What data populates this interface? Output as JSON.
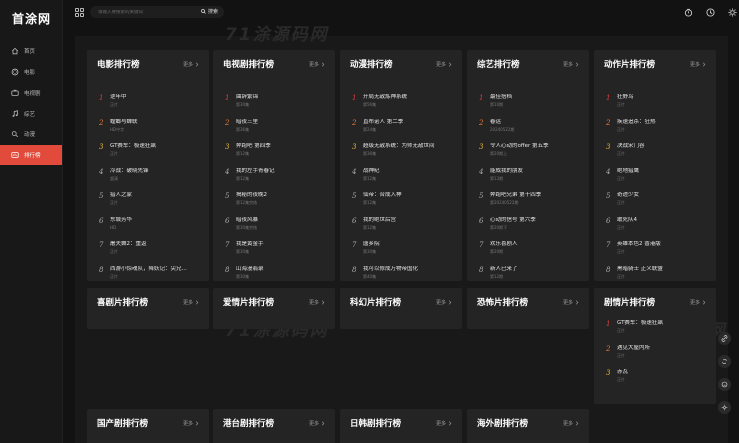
{
  "app": {
    "logo": "首涂网"
  },
  "sidebar": {
    "items": [
      {
        "label": "首页",
        "icon": "home-icon"
      },
      {
        "label": "电影",
        "icon": "film-reel-icon"
      },
      {
        "label": "电视剧",
        "icon": "tv-icon"
      },
      {
        "label": "综艺",
        "icon": "music-note-icon"
      },
      {
        "label": "动漫",
        "icon": "game-controller-icon"
      },
      {
        "label": "排行榜",
        "icon": "ranking-icon",
        "active": true
      }
    ]
  },
  "search": {
    "placeholder": "请输入要搜索的关键词",
    "button": "搜索"
  },
  "watermark": {
    "text": "71涂源码网"
  },
  "more_label": "更多",
  "cards": [
    {
      "title": "电影排行榜",
      "items": [
        {
          "name": "逆年中",
          "sub": "正片"
        },
        {
          "name": "螳螂与蝉联",
          "sub": "HD中字"
        },
        {
          "name": "GT赛车：极速狂飙",
          "sub": "正片"
        },
        {
          "name": "冷战：破晓先锋",
          "sub": "超清"
        },
        {
          "name": "猎人之家",
          "sub": "正片"
        },
        {
          "name": "东城芳华",
          "sub": "HD"
        },
        {
          "name": "屠夫舞2：重返",
          "sub": "正片"
        },
        {
          "name": "西游小惊魂队，降妖记：尖兄...",
          "sub": "正片"
        }
      ]
    },
    {
      "title": "电视剧排行榜",
      "items": [
        {
          "name": "曲辞繁锦",
          "sub": "第30集"
        },
        {
          "name": "暗夜三里",
          "sub": "第36集"
        },
        {
          "name": "奔跑吧 第四季",
          "sub": "第12集"
        },
        {
          "name": "我的左手青春记",
          "sub": "第12集"
        },
        {
          "name": "揭秘的夜晚2",
          "sub": "第12集完结"
        },
        {
          "name": "暗夜风暴",
          "sub": "第30集完结"
        },
        {
          "name": "我是黄金手",
          "sub": "第30集"
        },
        {
          "name": "山海漫翡录",
          "sub": "第30集"
        }
      ]
    },
    {
      "title": "动漫排行榜",
      "items": [
        {
          "name": "开局无敌炼神系统",
          "sub": "第56集"
        },
        {
          "name": "直布诺人 第二季",
          "sub": "第24集"
        },
        {
          "name": "超级无敌系统：为师无敌世间",
          "sub": "第36集"
        },
        {
          "name": "战神纪",
          "sub": "第12集"
        },
        {
          "name": "仙帝：合成入神",
          "sub": "第12集"
        },
        {
          "name": "我的绝世后宫",
          "sub": "第12集"
        },
        {
          "name": "唐乡院",
          "sub": "第30集"
        },
        {
          "name": "我可以修成万物帝国化",
          "sub": "第40集"
        }
      ]
    },
    {
      "title": "综艺排行榜",
      "items": [
        {
          "name": "最佳搭档",
          "sub": "第10期"
        },
        {
          "name": "春运",
          "sub": "20240522期"
        },
        {
          "name": "令人心动的offer 第五季",
          "sub": "第20期上"
        },
        {
          "name": "能成我的朋友",
          "sub": "第13期"
        },
        {
          "name": "奔跑吧兄弟 第十四季",
          "sub": "第20240522期"
        },
        {
          "name": "心动的信号 第六季",
          "sub": "第20期下"
        },
        {
          "name": "欢乐喜剧人",
          "sub": "第20期"
        },
        {
          "name": "新人已来了",
          "sub": "第12期"
        }
      ]
    },
    {
      "title": "动作片排行榜",
      "items": [
        {
          "name": "狂野鸟",
          "sub": "正片"
        },
        {
          "name": "疾速追杀：狂热",
          "sub": "正片"
        },
        {
          "name": "决战宋门谷",
          "sub": "正片"
        },
        {
          "name": "绝地猎鹰",
          "sub": "正片"
        },
        {
          "name": "奇迹少女",
          "sub": "正片"
        },
        {
          "name": "敢死队4",
          "sub": "正片"
        },
        {
          "name": "英雄本色2 香港版",
          "sub": "正片"
        },
        {
          "name": "黑暗骑士 正义联盟",
          "sub": "正片"
        }
      ]
    },
    {
      "title": "喜剧片排行榜",
      "items": []
    },
    {
      "title": "爱情片排行榜",
      "items": []
    },
    {
      "title": "科幻片排行榜",
      "items": []
    },
    {
      "title": "恐怖片排行榜",
      "items": []
    },
    {
      "title": "剧情片排行榜",
      "items": [
        {
          "name": "GT赛车：极速狂飙",
          "sub": "正片"
        },
        {
          "name": "遇见大屋内所",
          "sub": "正片"
        },
        {
          "name": "赤瓦",
          "sub": "正片"
        }
      ]
    },
    {
      "title": "国产剧排行榜",
      "items": []
    },
    {
      "title": "港台剧排行榜",
      "items": []
    },
    {
      "title": "日韩剧排行榜",
      "items": []
    },
    {
      "title": "海外剧排行榜",
      "items": []
    }
  ]
}
